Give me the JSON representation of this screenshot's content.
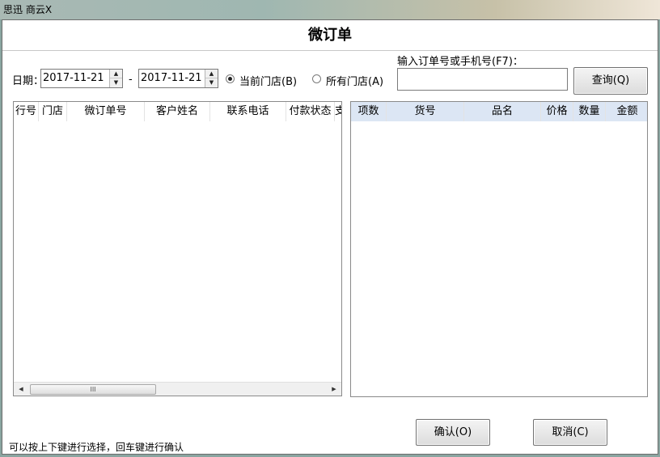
{
  "app": {
    "title": "思迅 商云X"
  },
  "dialog": {
    "title": "微订单"
  },
  "filters": {
    "date_label": "日期：",
    "date_from": "2017-11-21",
    "date_separator": "-",
    "date_to": "2017-11-21",
    "radio_current_store": "当前门店(B)",
    "radio_all_stores": "所有门店(A)",
    "radio_selected": "current_store",
    "search_label": "输入订单号或手机号(F7)：",
    "search_value": "",
    "query_button": "查询(Q)"
  },
  "left_table": {
    "columns": [
      "行号",
      "门店",
      "微订单号",
      "客户姓名",
      "联系电话",
      "付款状态",
      "支"
    ],
    "rows": []
  },
  "right_table": {
    "columns": [
      "项数",
      "货号",
      "品名",
      "价格",
      "数量",
      "金额"
    ],
    "rows": []
  },
  "scrollbar": {
    "grip": "III"
  },
  "footer": {
    "hint": "可以按上下键进行选择，回车键进行确认",
    "confirm_button": "确认(O)",
    "cancel_button": "取消(C)"
  },
  "icons": {
    "spin_up": "up-arrow-icon",
    "spin_down": "down-arrow-icon",
    "scroll_left": "left-arrow-icon",
    "scroll_right": "right-arrow-icon"
  },
  "colors": {
    "right_header_bg": "#dce6f4",
    "dialog_bg": "#ffffff",
    "border": "#8a8a8a"
  }
}
